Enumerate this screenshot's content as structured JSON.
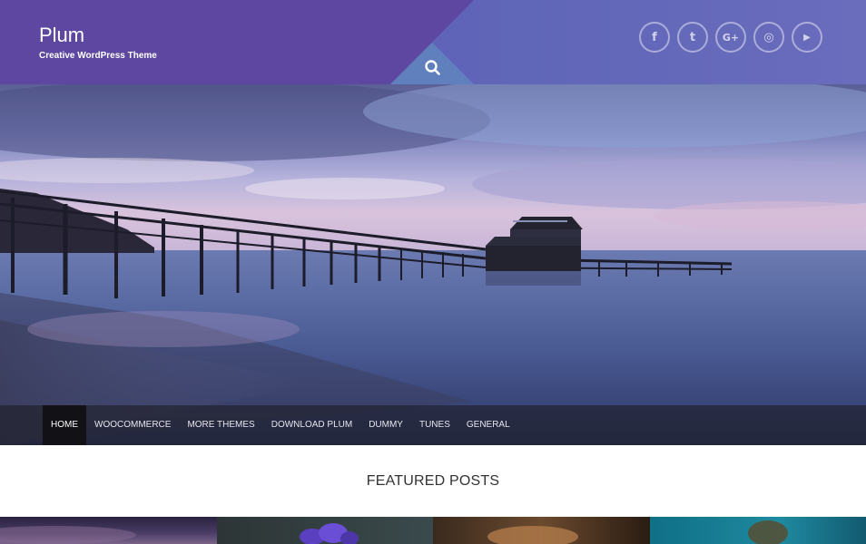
{
  "site": {
    "title": "Plum",
    "tagline": "Creative WordPress Theme"
  },
  "header": {
    "search_icon": "search-icon",
    "social": [
      {
        "name": "facebook",
        "icon": "facebook-icon",
        "glyph": "f"
      },
      {
        "name": "twitter",
        "icon": "twitter-icon",
        "glyph": "t"
      },
      {
        "name": "google-plus",
        "icon": "google-plus-icon",
        "glyph": "G+"
      },
      {
        "name": "instagram",
        "icon": "instagram-icon",
        "glyph": "◎"
      },
      {
        "name": "youtube",
        "icon": "youtube-icon",
        "glyph": "▶"
      }
    ]
  },
  "nav": {
    "items": [
      {
        "label": "HOME",
        "active": true
      },
      {
        "label": "WOOCOMMERCE"
      },
      {
        "label": "MORE THEMES"
      },
      {
        "label": "DOWNLOAD PLUM"
      },
      {
        "label": "DUMMY"
      },
      {
        "label": "TUNES"
      },
      {
        "label": "GENERAL"
      }
    ]
  },
  "featured": {
    "title": "FEATURED POSTS"
  },
  "colors": {
    "header_left": "#5d47a0",
    "header_right": "#6066b8",
    "nav_bg": "#1e1e28",
    "nav_active": "#111116"
  }
}
